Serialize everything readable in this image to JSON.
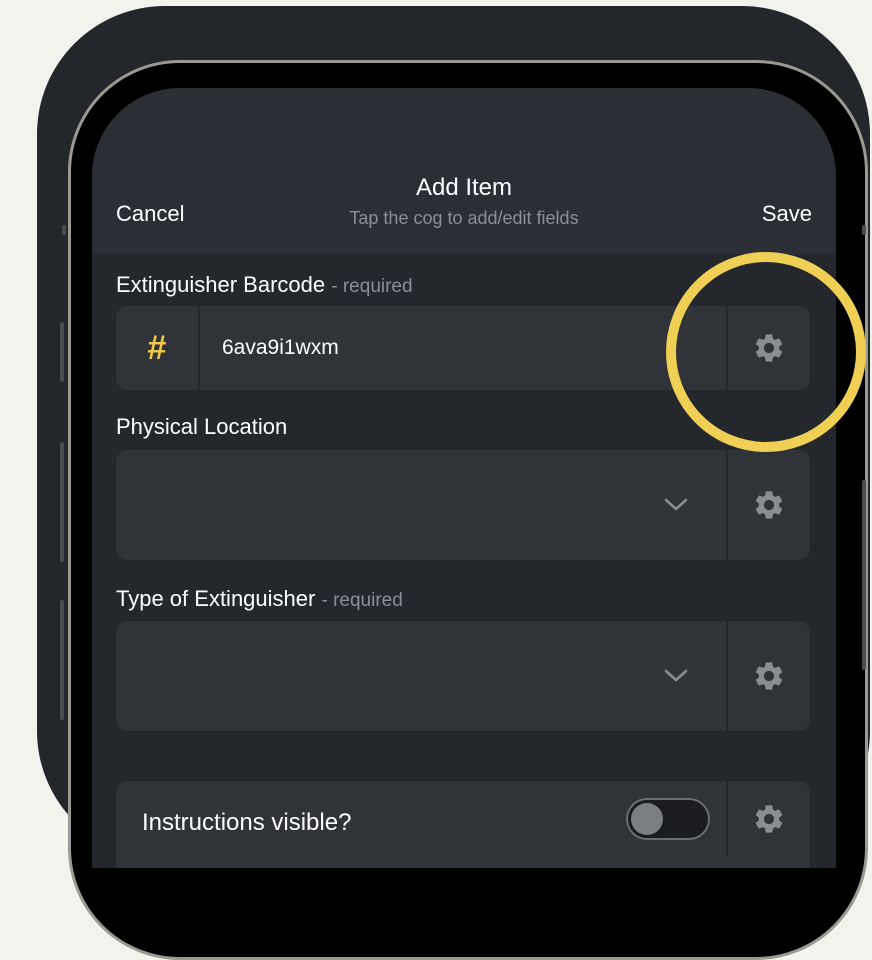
{
  "header": {
    "title": "Add Item",
    "subtitle": "Tap the cog to add/edit fields",
    "cancel_label": "Cancel",
    "save_label": "Save"
  },
  "fields": [
    {
      "label": "Extinguisher Barcode",
      "required_suffix": "- required",
      "value": "6ava9i1wxm",
      "icon": "hash-icon"
    },
    {
      "label": "Physical Location",
      "value": ""
    },
    {
      "label": "Type of Extinguisher",
      "required_suffix": "- required",
      "value": ""
    }
  ],
  "instructions": {
    "label": "Instructions visible?",
    "toggle_on": false
  },
  "colors": {
    "accent_yellow": "#f0cf55",
    "background": "#24282d",
    "field_bg": "#303338",
    "muted_text": "#8b8f96"
  },
  "icons": [
    "gear-icon",
    "chevron-down-icon",
    "hash-icon"
  ]
}
